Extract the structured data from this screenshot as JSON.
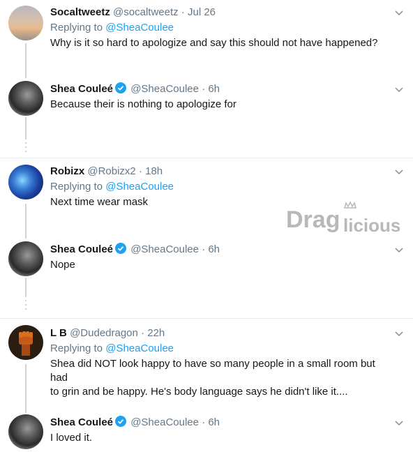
{
  "tweets": [
    {
      "name": "Socaltweetz",
      "handle": "@socaltweetz",
      "sep": "·",
      "time": "Jul 26",
      "replying_prefix": "Replying to",
      "replying_to": "@SheaCoulee",
      "text": "Why is it so hard to apologize and say this should not have happened?",
      "verified": false
    },
    {
      "name": "Shea Couleé",
      "handle": "@SheaCoulee",
      "sep": "·",
      "time": "6h",
      "text": "Because their is nothing to apologize for",
      "verified": true
    },
    {
      "name": "Robizx",
      "handle": "@Robizx2",
      "sep": "·",
      "time": "18h",
      "replying_prefix": "Replying to",
      "replying_to": "@SheaCoulee",
      "text": "Next time wear mask",
      "verified": false
    },
    {
      "name": "Shea Couleé",
      "handle": "@SheaCoulee",
      "sep": "·",
      "time": "6h",
      "text": "Nope",
      "verified": true
    },
    {
      "name": "L B",
      "handle": "@Dudedragon",
      "sep": "·",
      "time": "22h",
      "replying_prefix": "Replying to",
      "replying_to": "@SheaCoulee",
      "text_line1": "Shea did NOT look happy to have so many people in a small room but had",
      "text_line2": "to grin and be happy. He's body language says he didn't like it....",
      "verified": false
    },
    {
      "name": "Shea Couleé",
      "handle": "@SheaCoulee",
      "sep": "·",
      "time": "6h",
      "text": "I loved it.",
      "verified": true
    }
  ],
  "watermark": {
    "text_part1": "Drag",
    "text_part2": "licious"
  },
  "colors": {
    "link": "#1da1f2",
    "secondary_text": "#657786",
    "thread_line": "#ccd6dd",
    "divider": "#e6ecf0",
    "verified_badge": "#1da1f2"
  },
  "icons": [
    "chevron-down-icon",
    "verified-badge-icon"
  ]
}
